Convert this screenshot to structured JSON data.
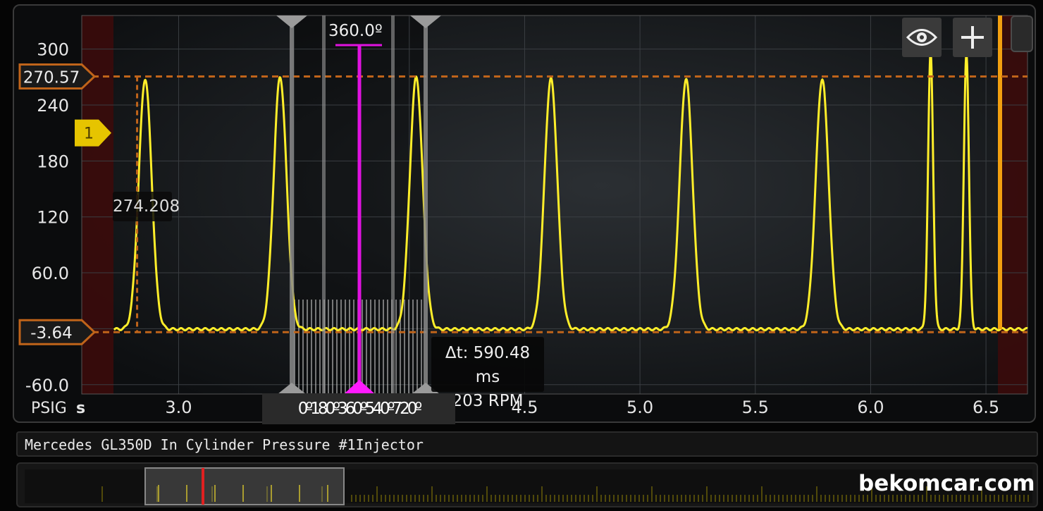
{
  "app": {
    "title": "Mercedes GL350D In Cylinder Pressure #1Injector",
    "watermark": "bekomcar.com"
  },
  "toolbar": {
    "view_icon": "eye-icon",
    "add_icon": "plus-icon"
  },
  "colors": {
    "trace": "#ffee2a",
    "cursor": "#e012e0",
    "hcursor": "#c0641a",
    "bg": "#131517"
  },
  "chart_data": {
    "type": "line",
    "title": "",
    "xlabel": "s",
    "ylabel": "PSIG",
    "xlim": [
      2.58,
      6.68
    ],
    "ylim": [
      -70,
      336
    ],
    "x_ticks": [
      "3.0",
      "3.5",
      "4.0",
      "4.5",
      "5.0",
      "5.5",
      "6.0",
      "6.5"
    ],
    "x_tick_values": [
      3.0,
      3.5,
      4.0,
      4.5,
      5.0,
      5.5,
      6.0,
      6.5
    ],
    "y_ticks": [
      "-60.0",
      "0",
      "60.0",
      "120",
      "180",
      "240",
      "300"
    ],
    "y_tick_values": [
      -60,
      0,
      60,
      120,
      180,
      240,
      300
    ],
    "baseline": -0.5,
    "series": [
      {
        "peaks": [
          {
            "x": 2.855,
            "y": 268
          },
          {
            "x": 3.44,
            "y": 270
          },
          {
            "x": 4.03,
            "y": 270
          },
          {
            "x": 4.614,
            "y": 268
          },
          {
            "x": 5.2,
            "y": 268
          },
          {
            "x": 5.79,
            "y": 268
          },
          {
            "x": 6.26,
            "y": 296
          },
          {
            "x": 6.415,
            "y": 296
          }
        ]
      }
    ],
    "cursors": {
      "h_upper": {
        "label": "270.57",
        "value": 270.57
      },
      "h_lower": {
        "label": "-3.64",
        "value": -3.64
      },
      "channel_marker": {
        "label": "1",
        "value": 210
      },
      "value_readout": "274.208",
      "angle_cursor_label": "360.0º",
      "angle_scale_label": "0º180º360º540º720º",
      "delta_t": "Δt: 590.48 ms",
      "rpm": "203 RPM"
    }
  }
}
